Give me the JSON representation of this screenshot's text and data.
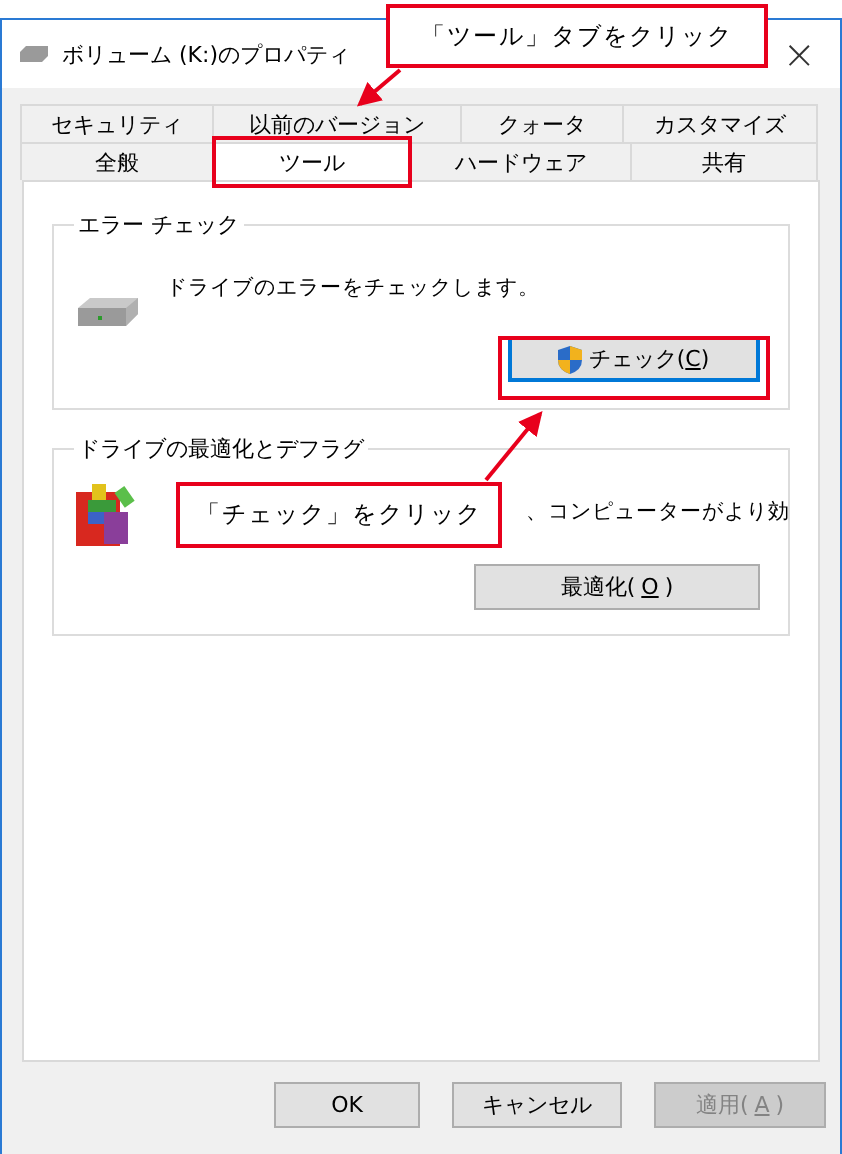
{
  "window": {
    "title": "ボリューム (K:)のプロパティ",
    "close": "×"
  },
  "tab_rows": [
    {
      "tabs": [
        {
          "label": "セキュリティ",
          "selected": false
        },
        {
          "label": "以前のバージョン",
          "selected": false
        },
        {
          "label": "クォータ",
          "selected": false
        },
        {
          "label": "カスタマイズ",
          "selected": false
        }
      ]
    },
    {
      "tabs": [
        {
          "label": "全般",
          "selected": false
        },
        {
          "label": "ツール",
          "selected": true,
          "highlighted": true
        },
        {
          "label": "ハードウェア",
          "selected": false
        },
        {
          "label": "共有",
          "selected": false
        }
      ]
    }
  ],
  "error_check": {
    "title": "エラー チェック",
    "description": "ドライブのエラーをチェックします。",
    "button": {
      "label_before": "チェック(",
      "access_key": "C",
      "label_after": ")",
      "highlighted": true
    }
  },
  "optimize": {
    "title": "ドライブの最適化とデフラグ",
    "description_visible": "、コンピューターがより効",
    "button": {
      "label_before": "最適化(",
      "access_key": "O",
      "label_after": ")"
    }
  },
  "buttons": [
    {
      "label_before": "OK",
      "disabled": false
    },
    {
      "label_before": "キャンセル",
      "disabled": false
    },
    {
      "label_before": "適用(",
      "access_key": "A",
      "label_after": ")",
      "disabled": true
    }
  ],
  "annotations": [
    {
      "text": "「ツール」タブをクリック"
    },
    {
      "text": "「チェック」をクリック"
    }
  ]
}
